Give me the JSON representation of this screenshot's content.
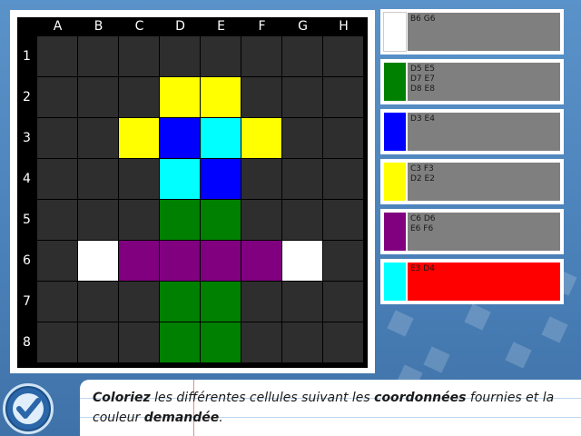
{
  "grid": {
    "columns": [
      "A",
      "B",
      "C",
      "D",
      "E",
      "F",
      "G",
      "H"
    ],
    "rows": [
      "1",
      "2",
      "3",
      "4",
      "5",
      "6",
      "7",
      "8"
    ],
    "empty_color": "#2e2e2e",
    "filled": [
      {
        "cell": "D2",
        "color": "#ffff00"
      },
      {
        "cell": "E2",
        "color": "#ffff00"
      },
      {
        "cell": "C3",
        "color": "#ffff00"
      },
      {
        "cell": "D3",
        "color": "#0000ff"
      },
      {
        "cell": "E3",
        "color": "#00ffff"
      },
      {
        "cell": "F3",
        "color": "#ffff00"
      },
      {
        "cell": "D4",
        "color": "#00ffff"
      },
      {
        "cell": "E4",
        "color": "#0000ff"
      },
      {
        "cell": "D5",
        "color": "#008000"
      },
      {
        "cell": "E5",
        "color": "#008000"
      },
      {
        "cell": "B6",
        "color": "#ffffff"
      },
      {
        "cell": "C6",
        "color": "#800080"
      },
      {
        "cell": "D6",
        "color": "#800080"
      },
      {
        "cell": "E6",
        "color": "#800080"
      },
      {
        "cell": "F6",
        "color": "#800080"
      },
      {
        "cell": "G6",
        "color": "#ffffff"
      },
      {
        "cell": "D7",
        "color": "#008000"
      },
      {
        "cell": "E7",
        "color": "#008000"
      },
      {
        "cell": "D8",
        "color": "#008000"
      },
      {
        "cell": "E8",
        "color": "#008000"
      }
    ]
  },
  "legend": [
    {
      "color": "#ffffff",
      "coords": "B6 G6",
      "box_color": "#7f7f7f"
    },
    {
      "color": "#008000",
      "coords": "D5 E5\nD7 E7\nD8 E8",
      "box_color": "#7f7f7f"
    },
    {
      "color": "#0000ff",
      "coords": "D3 E4",
      "box_color": "#7f7f7f"
    },
    {
      "color": "#ffff00",
      "coords": "C3 F3\nD2 E2",
      "box_color": "#7f7f7f"
    },
    {
      "color": "#800080",
      "coords": "C6 D6\nE6 F6",
      "box_color": "#7f7f7f"
    },
    {
      "color": "#00ffff",
      "coords": "E3 D4",
      "box_color": "#ff0000"
    }
  ],
  "instruction": {
    "w1": "Coloriez",
    "t1": " les différentes cellules suivant les ",
    "w2": "coordonnées",
    "t2": " fournies et la couleur ",
    "w3": "demandée",
    "t3": "."
  },
  "icons": {
    "validate": "check-icon"
  }
}
